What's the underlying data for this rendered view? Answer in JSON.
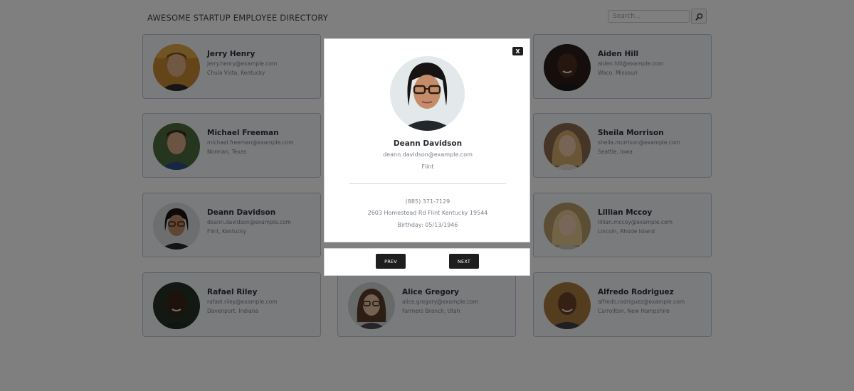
{
  "header": {
    "title": "AWESOME STARTUP EMPLOYEE DIRECTORY",
    "search_placeholder": "Search...",
    "search_icon": "magnifier-icon"
  },
  "employees": [
    {
      "name": "Jerry Henry",
      "email": "jerry.henry@example.com",
      "location": "Chula Vista, Kentucky"
    },
    {
      "name": "Aiden Hill",
      "email": "aiden.hill@example.com",
      "location": "Waco, Missouri"
    },
    {
      "name": "Michael Freeman",
      "email": "michael.freeman@example.com",
      "location": "Norman, Texas"
    },
    {
      "name": "Sheila Morrison",
      "email": "sheila.morrison@example.com",
      "location": "Seattle, Iowa"
    },
    {
      "name": "Deann Davidson",
      "email": "deann.davidson@example.com",
      "location": "Flint, Kentucky"
    },
    {
      "name": "Lillian Mccoy",
      "email": "lillian.mccoy@example.com",
      "location": "Lincoln, Rhode Island"
    },
    {
      "name": "Rafael Riley",
      "email": "rafael.riley@example.com",
      "location": "Davenport, Indiana"
    },
    {
      "name": "Alice Gregory",
      "email": "alice.gregory@example.com",
      "location": "Farmers Branch, Utah"
    },
    {
      "name": "Alfredo Rodriguez",
      "email": "alfredo.rodriguez@example.com",
      "location": "Carrollton, New Hampshire"
    }
  ],
  "modal": {
    "close_label": "X",
    "name": "Deann Davidson",
    "email": "deann.davidson@example.com",
    "city": "Flint",
    "phone": "(885) 371-7129",
    "address": "2603 Homestead Rd Flint Kentucky 19544",
    "birthday": "Birthday: 05/13/1946",
    "prev_label": "PREV",
    "next_label": "NEXT"
  },
  "colors": {
    "overlay": "rgba(0,0,0,0.5)",
    "card_border": "#b8c4d6",
    "card_bg": "#f4f7fb",
    "button_dark": "#1e1e1e"
  }
}
